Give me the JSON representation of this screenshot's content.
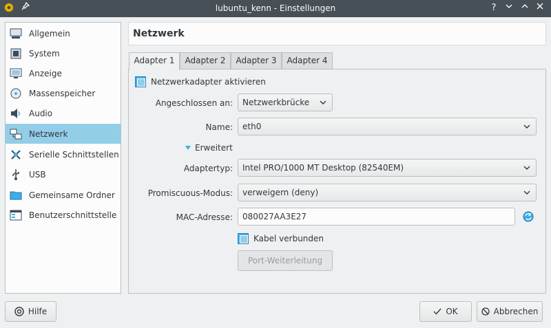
{
  "window": {
    "title": "lubuntu_kenn - Einstellungen"
  },
  "sidebar": {
    "items": [
      {
        "label": "Allgemein",
        "icon": "general-icon"
      },
      {
        "label": "System",
        "icon": "system-icon"
      },
      {
        "label": "Anzeige",
        "icon": "display-icon"
      },
      {
        "label": "Massenspeicher",
        "icon": "storage-icon"
      },
      {
        "label": "Audio",
        "icon": "audio-icon"
      },
      {
        "label": "Netzwerk",
        "icon": "network-icon",
        "active": true
      },
      {
        "label": "Serielle Schnittstellen",
        "icon": "serial-icon"
      },
      {
        "label": "USB",
        "icon": "usb-icon"
      },
      {
        "label": "Gemeinsame Ordner",
        "icon": "shared-folder-icon"
      },
      {
        "label": "Benutzerschnittstelle",
        "icon": "user-interface-icon"
      }
    ]
  },
  "header": {
    "title": "Netzwerk"
  },
  "tabs": [
    {
      "label": "Adapter 1",
      "active": true
    },
    {
      "label": "Adapter 2"
    },
    {
      "label": "Adapter 3"
    },
    {
      "label": "Adapter 4"
    }
  ],
  "form": {
    "enable_label": "Netzwerkadapter aktivieren",
    "attached_label": "Angeschlossen an:",
    "attached_value": "Netzwerkbrücke",
    "name_label": "Name:",
    "name_value": "eth0",
    "advanced_label": "Erweitert",
    "adapter_type_label": "Adaptertyp:",
    "adapter_type_value": "Intel PRO/1000 MT Desktop (82540EM)",
    "promisc_label": "Promiscuous-Modus:",
    "promisc_value": "verweigern (deny)",
    "mac_label": "MAC-Adresse:",
    "mac_value": "080027AA3E27",
    "cable_label": "Kabel verbunden",
    "port_forward_label": "Port-Weiterleitung"
  },
  "footer": {
    "help_label": "Hilfe",
    "ok_label": "OK",
    "cancel_label": "Abbrechen"
  },
  "colors": {
    "accent": "#3daee9",
    "selection": "#93cee9",
    "titlebar": "#475057"
  }
}
